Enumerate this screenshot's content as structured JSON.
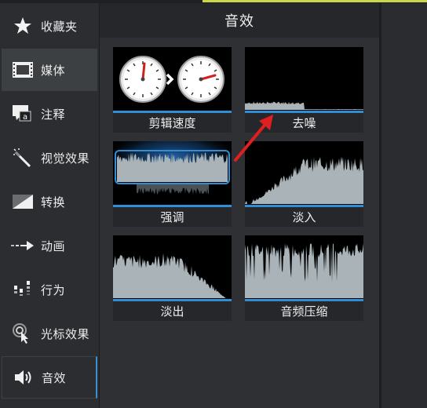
{
  "sidebar": {
    "items": [
      {
        "label": "收藏夹",
        "icon": "star-icon"
      },
      {
        "label": "媒体",
        "icon": "film-icon"
      },
      {
        "label": "注释",
        "icon": "annotation-icon"
      },
      {
        "label": "视觉效果",
        "icon": "magic-wand-icon"
      },
      {
        "label": "转换",
        "icon": "transition-icon"
      },
      {
        "label": "动画",
        "icon": "animation-arrow-icon"
      },
      {
        "label": "行为",
        "icon": "behavior-icon"
      },
      {
        "label": "光标效果",
        "icon": "cursor-effect-icon"
      },
      {
        "label": "音效",
        "icon": "speaker-icon"
      }
    ],
    "selected": "媒体",
    "current": "音效"
  },
  "panel": {
    "title": "音效",
    "effects": [
      {
        "label": "剪辑速度"
      },
      {
        "label": "去噪"
      },
      {
        "label": "强调"
      },
      {
        "label": "淡入"
      },
      {
        "label": "淡出"
      },
      {
        "label": "音频压缩"
      }
    ]
  },
  "colors": {
    "accent_blue": "#2f8fd6",
    "waveform": "#a9b3b8",
    "annotation_arrow": "#e02020",
    "top_accent": "#c8d84a"
  }
}
